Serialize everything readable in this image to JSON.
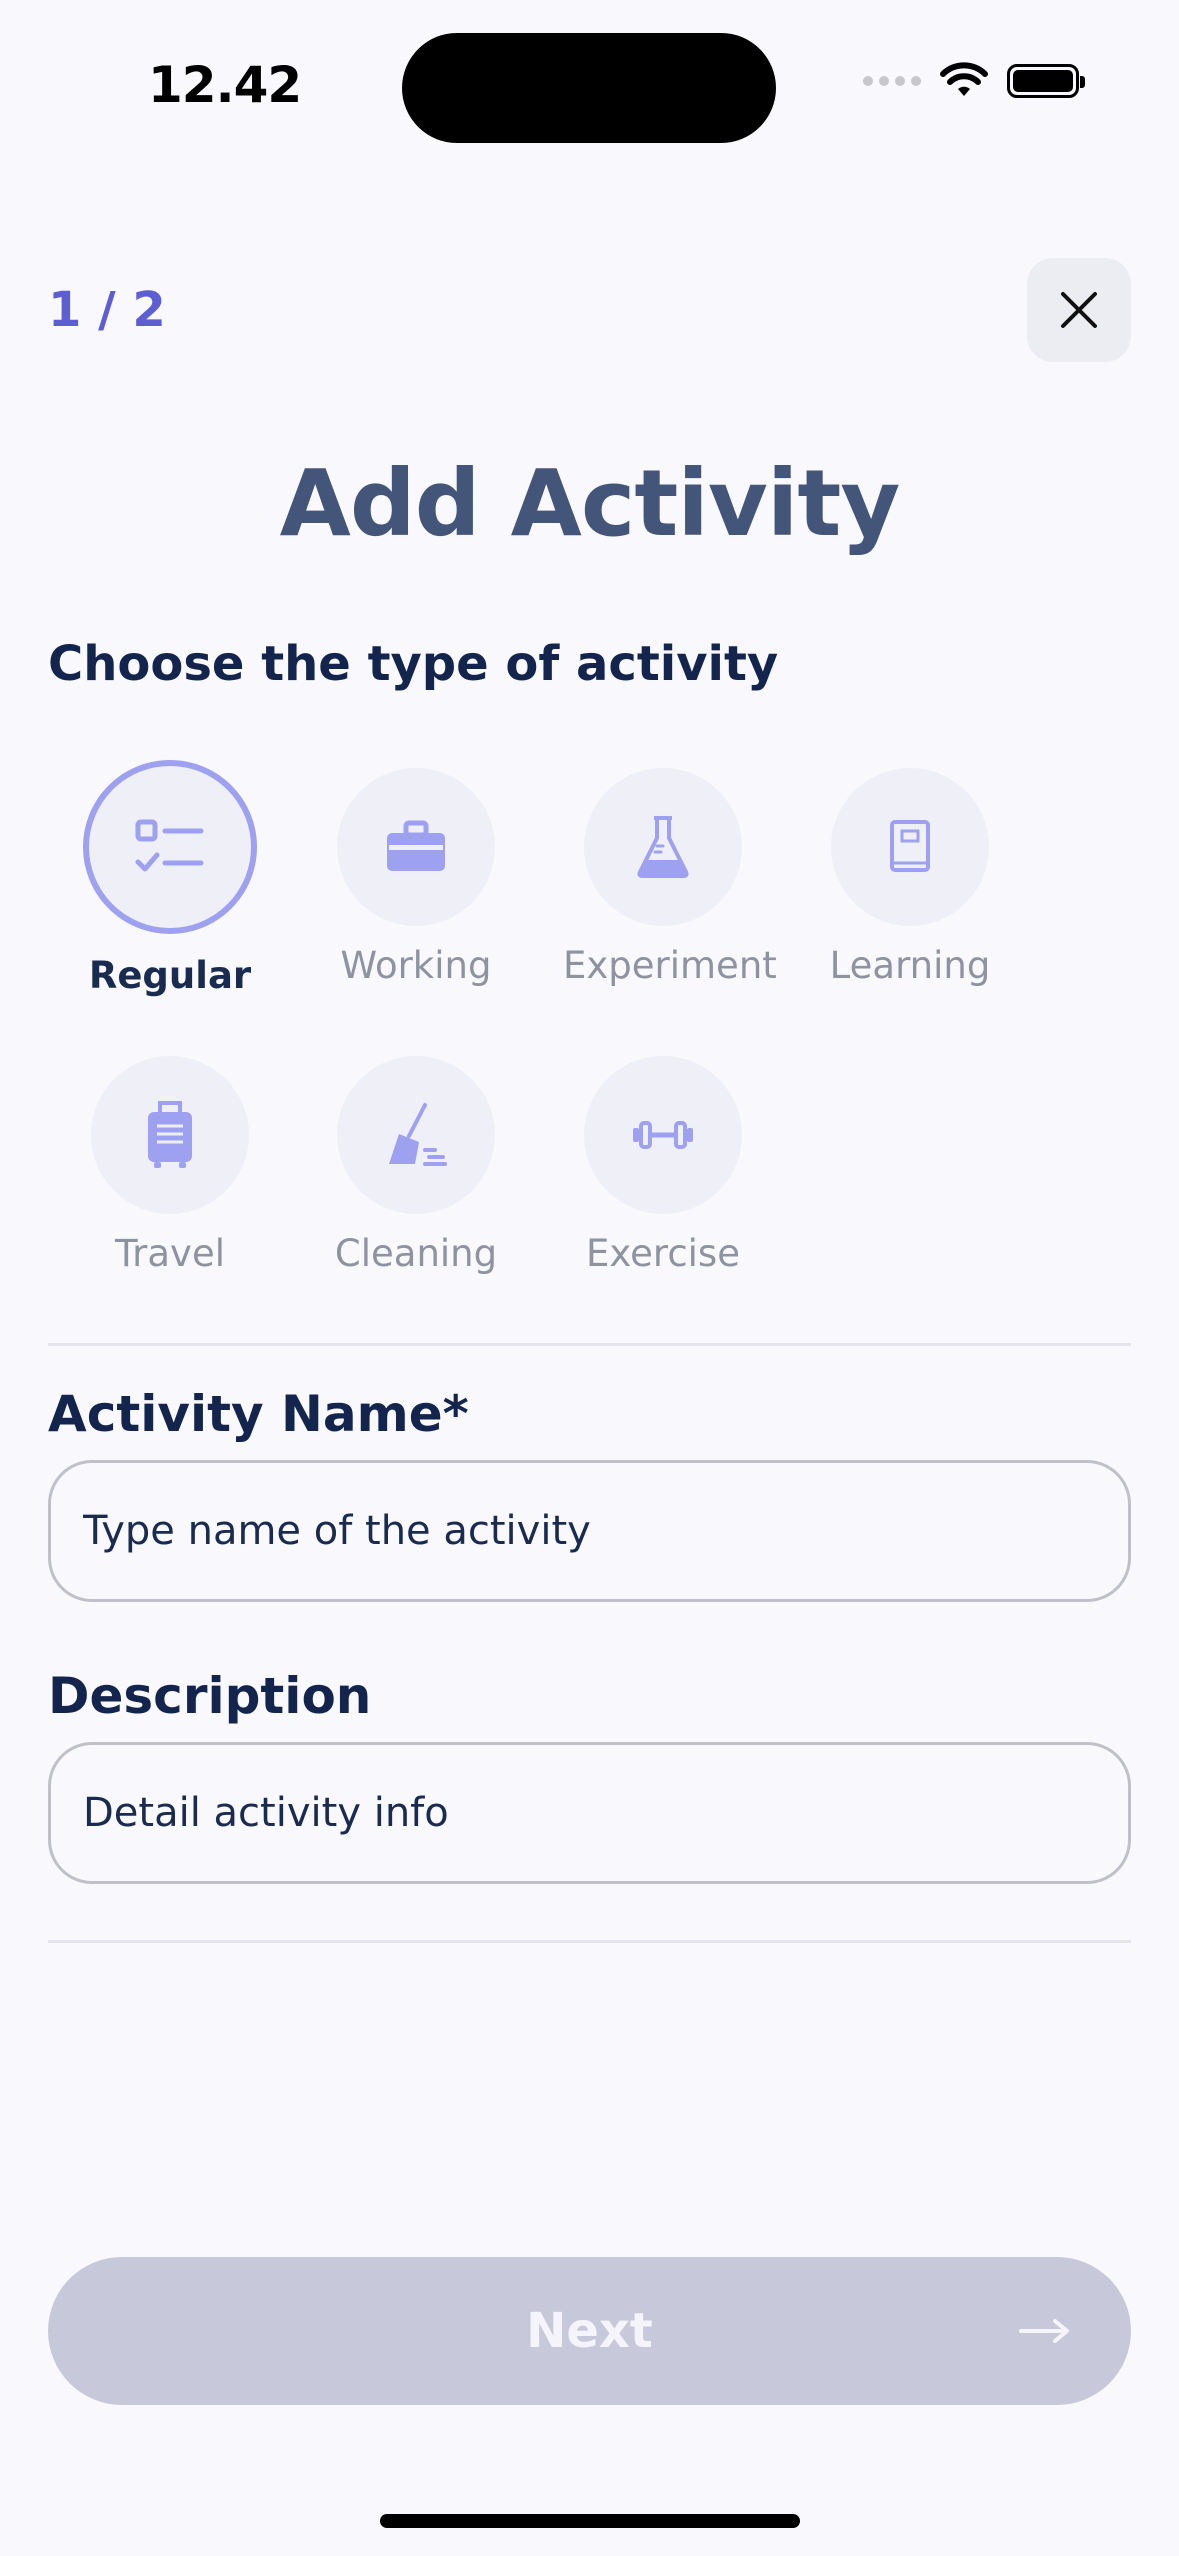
{
  "status_bar": {
    "time": "12.42"
  },
  "header": {
    "step": "1 / 2",
    "title": "Add Activity"
  },
  "activity_types": {
    "label": "Choose the type of activity",
    "items": [
      {
        "label": "Regular",
        "icon": "checklist-icon",
        "selected": true
      },
      {
        "label": "Working",
        "icon": "briefcase-icon",
        "selected": false
      },
      {
        "label": "Experiment",
        "icon": "flask-icon",
        "selected": false
      },
      {
        "label": "Learning",
        "icon": "book-icon",
        "selected": false
      },
      {
        "label": "Travel",
        "icon": "suitcase-icon",
        "selected": false
      },
      {
        "label": "Cleaning",
        "icon": "broom-icon",
        "selected": false
      },
      {
        "label": "Exercise",
        "icon": "dumbbell-icon",
        "selected": false
      }
    ]
  },
  "form": {
    "name_label": "Activity Name*",
    "name_placeholder": "Type name of the activity",
    "name_value": "",
    "description_label": "Description",
    "description_placeholder": "Detail activity info",
    "description_value": ""
  },
  "footer": {
    "next_label": "Next",
    "next_arrow": "→"
  },
  "colors": {
    "accent": "#5e5ed3",
    "icon": "#9ea0f0",
    "title": "#44557a",
    "button_disabled": "#c8c8db",
    "background": "#f8f8fd"
  }
}
